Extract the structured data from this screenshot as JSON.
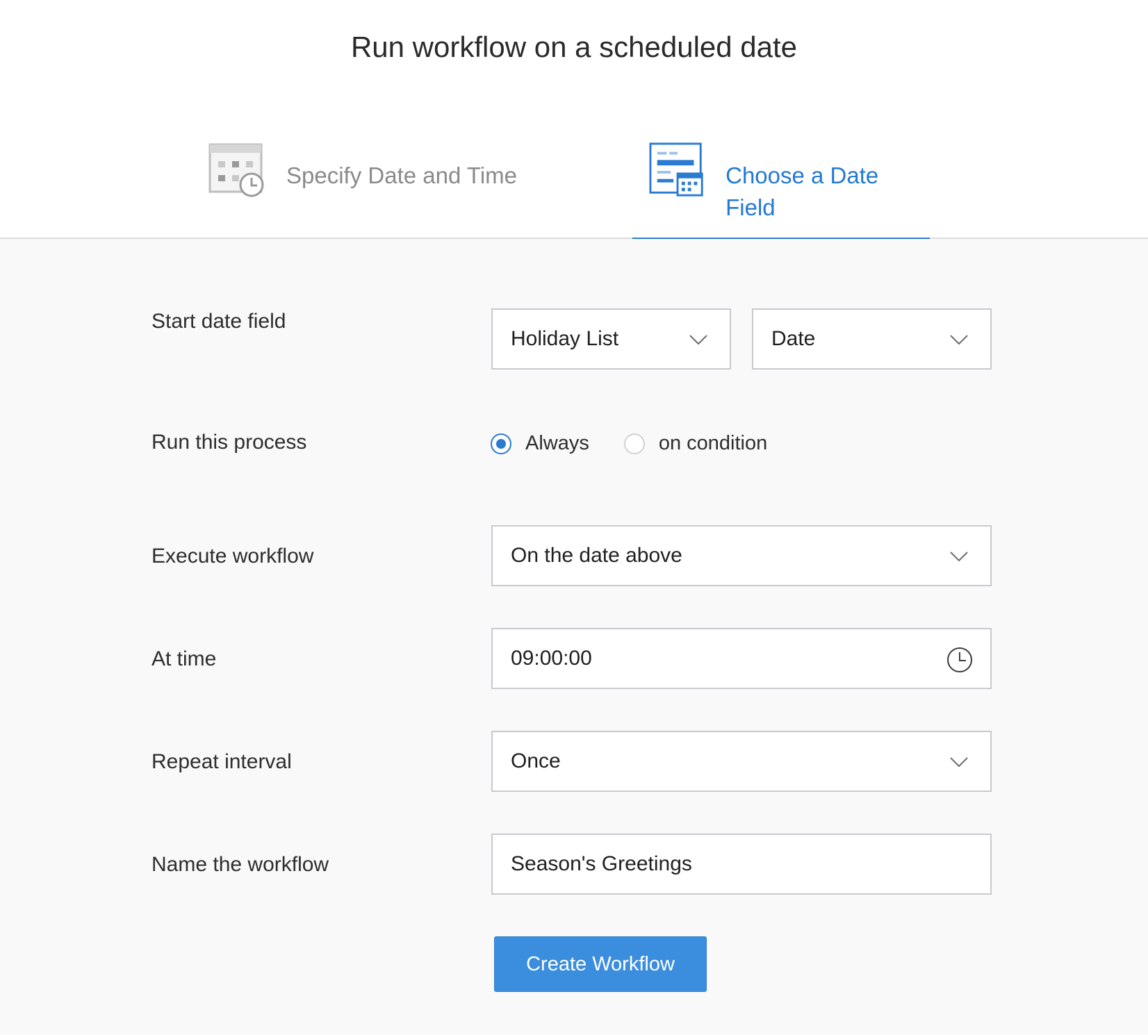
{
  "page": {
    "title": "Run workflow on a scheduled date"
  },
  "tabs": [
    {
      "label": "Specify Date and Time",
      "icon": "calendar-clock-icon",
      "active": false
    },
    {
      "label": "Choose a Date Field",
      "icon": "date-field-form-icon",
      "active": true
    }
  ],
  "colors": {
    "accent": "#2b7bd1",
    "button": "#3b8ddd",
    "inactive_tab": "#8a8a8a",
    "form_bg": "#f9f9f9"
  },
  "form": {
    "start_date_field": {
      "label": "Start date field",
      "form_value": "Holiday List",
      "field_value": "Date"
    },
    "run_process": {
      "label": "Run this process",
      "options": [
        "Always",
        "on condition"
      ],
      "selected": "Always"
    },
    "execute_workflow": {
      "label": "Execute workflow",
      "value": "On the date above"
    },
    "at_time": {
      "label": "At time",
      "value": "09:00:00"
    },
    "repeat_interval": {
      "label": "Repeat interval",
      "value": "Once"
    },
    "workflow_name": {
      "label": "Name the workflow",
      "value": "Season's Greetings"
    },
    "submit_label": "Create Workflow"
  }
}
